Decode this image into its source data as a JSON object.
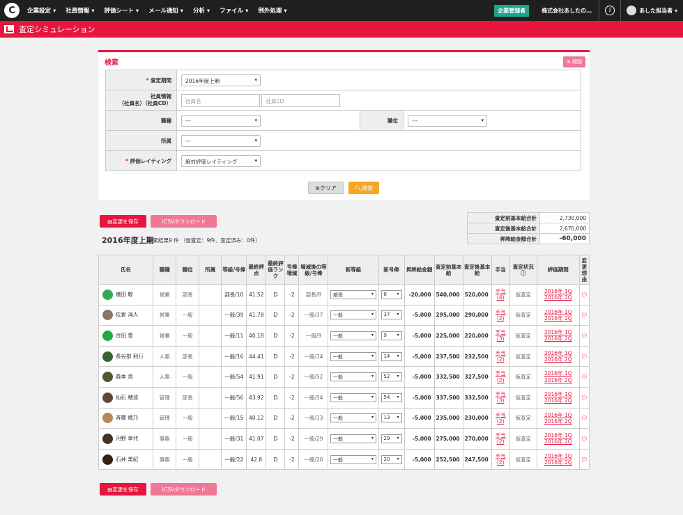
{
  "nav": {
    "logo": "C",
    "menus": [
      "企業設定 ▾",
      "社員情報 ▾",
      "評価シート ▾",
      "メール通知 ▾",
      "分析 ▾",
      "ファイル ▾",
      "例外処理 ▾"
    ],
    "admin_badge": "企業管理者",
    "company": "株式会社あしたの…",
    "info": "i",
    "user": "あした担当者 ▾"
  },
  "page": {
    "title": "査定シミュレーション"
  },
  "search": {
    "title": "検索",
    "open_button": "開閉",
    "period_label": "査定期間",
    "period_value": "2016年度上期",
    "employee_label": "社員情報（社員名）（社員CD）",
    "employee_label_l1": "社員情報",
    "employee_label_l2": "（社員名）（社員CD）",
    "name_placeholder": "社員名",
    "cd_placeholder": "社員CD",
    "job_label": "職種",
    "job_value": "---",
    "position_label": "職位",
    "position_value": "---",
    "dept_label": "所属",
    "dept_value": "---",
    "rating_label": "評価レイティング",
    "rating_value": "絶対評価レイティング",
    "clear_button": "クリア",
    "search_button": "検索"
  },
  "actions": {
    "save": "変更を保存",
    "csv": "CSVダウンロード"
  },
  "summary": {
    "before_label": "査定前基本給合計",
    "before_value": "2,730,000",
    "after_label": "査定後基本給合計",
    "after_value": "2,670,000",
    "diff_label": "昇降給金額合計",
    "diff_value": "-60,000"
  },
  "result": {
    "period": "2016年度上期",
    "text": "検索結果9 件 （仮査定：9件、査定済み：0件）"
  },
  "table": {
    "headers": [
      "氏名",
      "職種",
      "職位",
      "所属",
      "等級/号俸",
      "最終評点",
      "最終評価ランク",
      "号俸増減",
      "増減後の等級/号俸",
      "新等級",
      "新号俸",
      "昇降給金額",
      "査定前基本給",
      "査定後基本給",
      "手当",
      "査定状況",
      "評価期間",
      "変更理由"
    ],
    "rows": [
      {
        "name": "織田 敬",
        "job": "営業",
        "pos": "部長",
        "grade": "部長/10",
        "score": "41.52",
        "rank": "D",
        "inc": "-2",
        "after": "部長/8",
        "new_grade": "部長",
        "new_step": "8",
        "diff": "-20,000",
        "before_pay": "540,000",
        "after_pay": "520,000",
        "allow": "手当(4)",
        "status": "仮査定",
        "period": "2016年 1Q 2016年 2Q",
        "color": "#3a5"
      },
      {
        "name": "佐倉 海人",
        "job": "営業",
        "pos": "一般",
        "grade": "一般/39",
        "score": "41.78",
        "rank": "D",
        "inc": "-2",
        "after": "一般/37",
        "new_grade": "一般",
        "new_step": "37",
        "diff": "-5,000",
        "before_pay": "295,000",
        "after_pay": "290,000",
        "allow": "手当(2)",
        "status": "仮査定",
        "period": "2016年 1Q 2016年 2Q",
        "color": "#876"
      },
      {
        "name": "合田 豊",
        "job": "営業",
        "pos": "一般",
        "grade": "一般/11",
        "score": "40.18",
        "rank": "D",
        "inc": "-2",
        "after": "一般/9",
        "new_grade": "一般",
        "new_step": "9",
        "diff": "-5,000",
        "before_pay": "225,000",
        "after_pay": "220,000",
        "allow": "手当(3)",
        "status": "仮査定",
        "period": "2016年 1Q 2016年 2Q",
        "color": "#2a4"
      },
      {
        "name": "長谷部 利行",
        "job": "人事",
        "pos": "部長",
        "grade": "一般/16",
        "score": "44.41",
        "rank": "D",
        "inc": "-2",
        "after": "一般/14",
        "new_grade": "一般",
        "new_step": "14",
        "diff": "-5,000",
        "before_pay": "237,500",
        "after_pay": "232,500",
        "allow": "手当(2)",
        "status": "仮査定",
        "period": "2016年 1Q 2016年 2Q",
        "color": "#363"
      },
      {
        "name": "森本 良",
        "job": "人事",
        "pos": "一般",
        "grade": "一般/54",
        "score": "41.91",
        "rank": "D",
        "inc": "-2",
        "after": "一般/52",
        "new_grade": "一般",
        "new_step": "52",
        "diff": "-5,000",
        "before_pay": "332,500",
        "after_pay": "327,500",
        "allow": "手当(2)",
        "status": "仮査定",
        "period": "2016年 1Q 2016年 2Q",
        "color": "#553"
      },
      {
        "name": "仙石 穂波",
        "job": "管理",
        "pos": "部長",
        "grade": "一般/56",
        "score": "43.92",
        "rank": "D",
        "inc": "-2",
        "after": "一般/54",
        "new_grade": "一般",
        "new_step": "54",
        "diff": "-5,000",
        "before_pay": "337,500",
        "after_pay": "332,500",
        "allow": "手当(3)",
        "status": "仮査定",
        "period": "2016年 1Q 2016年 2Q",
        "color": "#643"
      },
      {
        "name": "斉藤 綾乃",
        "job": "管理",
        "pos": "一般",
        "grade": "一般/15",
        "score": "40.12",
        "rank": "D",
        "inc": "-2",
        "after": "一般/13",
        "new_grade": "一般",
        "new_step": "13",
        "diff": "-5,000",
        "before_pay": "235,000",
        "after_pay": "230,000",
        "allow": "手当(2)",
        "status": "仮査定",
        "period": "2016年 1Q 2016年 2Q",
        "color": "#b85"
      },
      {
        "name": "河野 幸代",
        "job": "事務",
        "pos": "一般",
        "grade": "一般/31",
        "score": "41.07",
        "rank": "D",
        "inc": "-2",
        "after": "一般/29",
        "new_grade": "一般",
        "new_step": "29",
        "diff": "-5,000",
        "before_pay": "275,000",
        "after_pay": "270,000",
        "allow": "手当(2)",
        "status": "仮査定",
        "period": "2016年 1Q 2016年 2Q",
        "color": "#432"
      },
      {
        "name": "石井 美紀",
        "job": "事務",
        "pos": "一般",
        "grade": "一般/22",
        "score": "42.8",
        "rank": "D",
        "inc": "-2",
        "after": "一般/20",
        "new_grade": "一般",
        "new_step": "20",
        "diff": "-5,000",
        "before_pay": "252,500",
        "after_pay": "247,500",
        "allow": "手当(2)",
        "status": "仮査定",
        "period": "2016年 1Q 2016年 2Q",
        "color": "#321"
      }
    ]
  }
}
